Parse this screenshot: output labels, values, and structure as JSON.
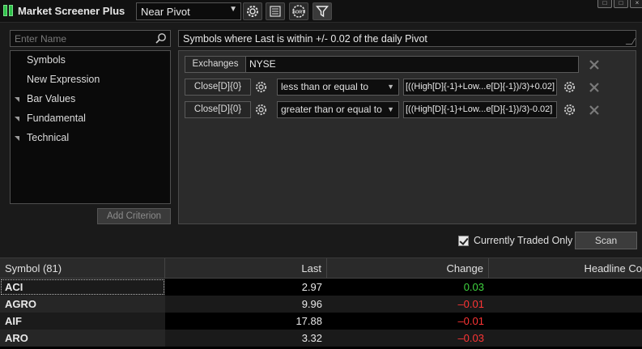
{
  "app": {
    "title": "Market Screener Plus"
  },
  "toolbar": {
    "preset": "Near Pivot",
    "icons": [
      "settings-icon",
      "list-icon",
      "sort-icon",
      "filter-icon"
    ],
    "sort_label": "SORT"
  },
  "search": {
    "placeholder": "Enter Name"
  },
  "tree": {
    "items": [
      {
        "label": "Symbols",
        "expandable": false
      },
      {
        "label": "New Expression",
        "expandable": false
      },
      {
        "label": "Bar Values",
        "expandable": true
      },
      {
        "label": "Fundamental",
        "expandable": true
      },
      {
        "label": "Technical",
        "expandable": true
      }
    ]
  },
  "add_criterion_label": "Add Criterion",
  "description": "Symbols where Last is within +/- 0.02 of the daily Pivot",
  "criteria": {
    "exchange": {
      "label": "Exchanges",
      "value": "NYSE"
    },
    "rows": [
      {
        "field": "Close[D]{0}",
        "operator": "less than or equal to",
        "expression": "[((High[D]{-1}+Low...e[D]{-1})/3)+0.02]"
      },
      {
        "field": "Close[D]{0}",
        "operator": "greater than or equal to",
        "expression": "[((High[D]{-1}+Low...e[D]{-1})/3)-0.02]"
      }
    ]
  },
  "currently_traded": {
    "label": "Currently Traded Only",
    "checked": true
  },
  "scan_label": "Scan",
  "grid": {
    "headers": {
      "symbol": "Symbol (81)",
      "last": "Last",
      "change": "Change",
      "headline": "Headline Co"
    },
    "rows": [
      {
        "symbol": "ACI",
        "last": "2.97",
        "change": "0.03",
        "dir": "up"
      },
      {
        "symbol": "AGRO",
        "last": "9.96",
        "change": "–0.01",
        "dir": "down"
      },
      {
        "symbol": "AIF",
        "last": "17.88",
        "change": "–0.01",
        "dir": "down"
      },
      {
        "symbol": "ARO",
        "last": "3.32",
        "change": "–0.03",
        "dir": "down"
      }
    ]
  },
  "colors": {
    "up": "#3fd43f",
    "down": "#ff3535",
    "accent": "#2ec24a"
  }
}
